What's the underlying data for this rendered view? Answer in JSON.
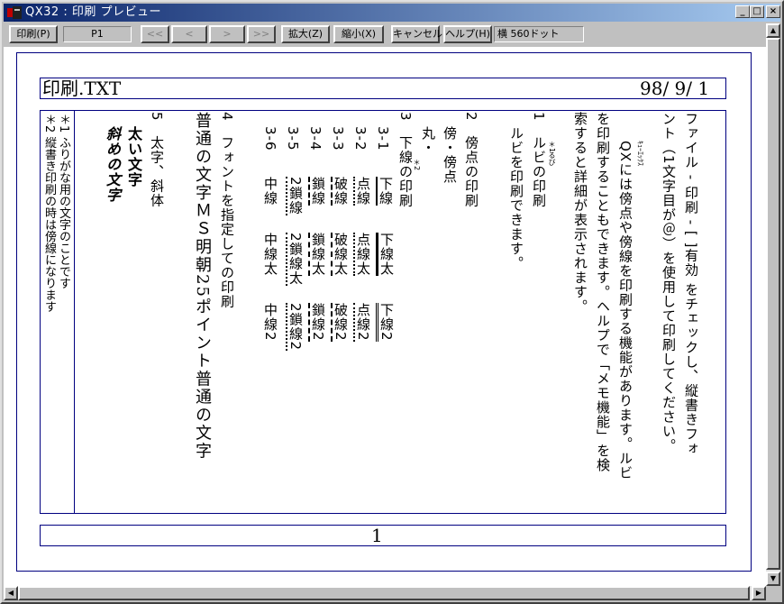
{
  "window": {
    "title": "QX32 : 印刷 プレビュー",
    "controls": {
      "minimize": "_",
      "maximize": "□",
      "close": "×"
    }
  },
  "toolbar": {
    "print": "印刷(P)",
    "page": "P1",
    "first": "<<",
    "prev": "<",
    "next": ">",
    "last": ">>",
    "zoom_in": "拡大(Z)",
    "zoom_out": "縮小(X)",
    "cancel": "キャンセル",
    "help": "ヘルプ(H)",
    "dots": "横 560ドット"
  },
  "page": {
    "header_left": "印刷.TXT",
    "header_right": "98/ 9/ 1",
    "footer": "1",
    "columns": [
      "ファイル - 印刷 - [ ]有効 をチェックし、縦書きフォ",
      "ント（1文字目が＠）を使用して印刷してください。",
      "QXには傍点や傍線を印刷する機能があります。ルビ",
      "を印刷することもできます。ヘルプで「メモ機能」を検",
      "索すると詳細が表示されます。",
      "1　ルビの印刷",
      "ルビを印刷できます。",
      "2　傍点の印刷",
      "傍・傍点",
      "丸・",
      "3　下線の印刷",
      "3-1 下線 下線太 下線2",
      "3-2 点線 点線太 点線2",
      "3-3 破線 破線太 破線2",
      "3-4 鎖線 鎖線太 鎖線2",
      "3-5 2鎖線 2鎖線太 2鎖線2",
      "3-6 中線 中線太 中線2",
      "4　フォントを指定しての印刷",
      "普通の文字ＭＳ明朝25ポイント普通の文字",
      "5　太字、斜体",
      "太い文字",
      "斜めの文字"
    ],
    "sub": {
      "c311": "下線",
      "c312": "下線太",
      "c313": "下線2",
      "c321": "点線",
      "c322": "点線太",
      "c323": "点線2",
      "c331": "破線",
      "c332": "破線太",
      "c333": "破線2",
      "c341": "鎖線",
      "c342": "鎖線太",
      "c343": "鎖線2",
      "c351": "2鎖線",
      "c352": "2鎖線太",
      "c353": "2鎖線2",
      "c361": "中線",
      "c362": "中線太",
      "c363": "中線2",
      "n31": "3-1",
      "n32": "3-2",
      "n33": "3-3",
      "n34": "3-4",
      "n35": "3-5",
      "n36": "3-6"
    },
    "ruby": {
      "qx": "ｷｭｰｴｯｸｽ",
      "rubi": "るび",
      "star": "＊1",
      "shita": "＊2"
    },
    "margin_notes": [
      "＊1 ふりがな用の文字のことです",
      "＊2 縦書き印刷の時は傍線になります"
    ]
  },
  "colors": {
    "accent": "#000080",
    "titlebar": "#0a246a"
  }
}
